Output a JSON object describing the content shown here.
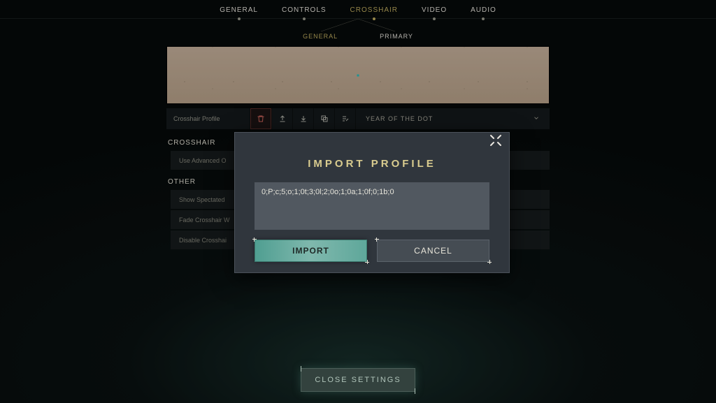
{
  "nav": {
    "main": [
      {
        "label": "GENERAL",
        "active": false,
        "hasdot": true
      },
      {
        "label": "CONTROLS",
        "active": false,
        "hasdot": true
      },
      {
        "label": "CROSSHAIR",
        "active": true,
        "hasdot": true
      },
      {
        "label": "VIDEO",
        "active": false,
        "hasdot": true
      },
      {
        "label": "AUDIO",
        "active": false,
        "hasdot": true
      }
    ],
    "sub": [
      {
        "label": "GENERAL",
        "active": true
      },
      {
        "label": "PRIMARY",
        "active": false
      }
    ]
  },
  "profile": {
    "label": "Crosshair Profile",
    "selected": "YEAR OF THE DOT",
    "icons": {
      "delete": "trash-icon",
      "export": "upload-icon",
      "import": "download-icon",
      "duplicate": "copy-icon",
      "edit": "edit-list-icon"
    }
  },
  "sections": {
    "crosshair_header": "CROSSHAIR",
    "other_header": "OTHER",
    "rows": {
      "advanced": "Use Advanced O",
      "spectated": "Show Spectated",
      "fade": "Fade Crosshair W",
      "disable": "Disable Crosshai"
    }
  },
  "modal": {
    "title": "IMPORT PROFILE",
    "code": "0;P;c;5;o;1;0t;3;0l;2;0o;1;0a;1;0f;0;1b;0",
    "import_label": "IMPORT",
    "cancel_label": "CANCEL"
  },
  "footer": {
    "close_label": "CLOSE SETTINGS"
  }
}
